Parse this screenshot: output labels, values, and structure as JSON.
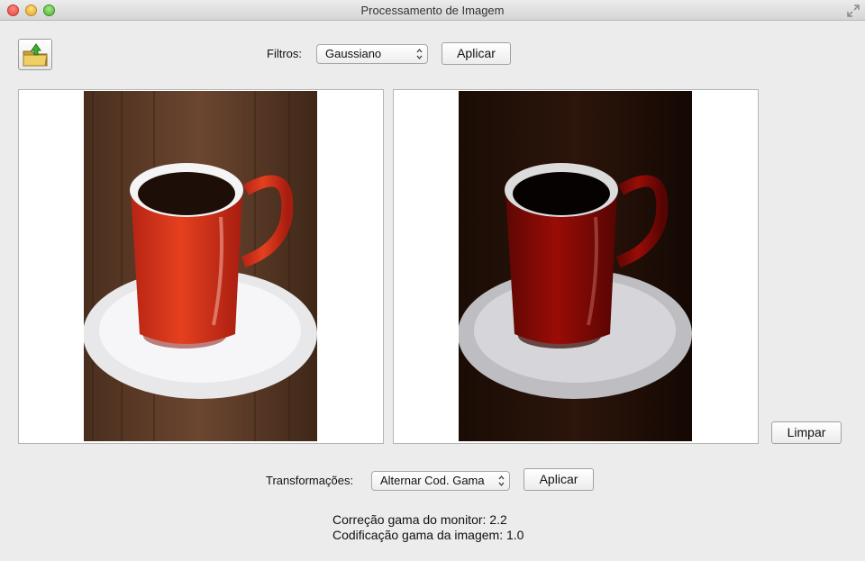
{
  "window": {
    "title": "Processamento de Imagem"
  },
  "toolbar": {
    "open_icon": "folder-upload-icon",
    "filters_label": "Filtros:",
    "filters_selected": "Gaussiano",
    "filters_apply": "Aplicar"
  },
  "images": {
    "original_label": "",
    "processed_label": ""
  },
  "actions": {
    "clear_label": "Limpar"
  },
  "transforms": {
    "label": "Transformações:",
    "selected": "Alternar Cod. Gama",
    "apply": "Aplicar"
  },
  "status": {
    "monitor_gamma": "Correção gama do monitor: 2.2",
    "image_gamma": "Codificação gama da imagem: 1.0"
  },
  "colors": {
    "cup_red": "#d8321c",
    "wood": "#5a3a26",
    "saucer": "#f2f2f4"
  }
}
